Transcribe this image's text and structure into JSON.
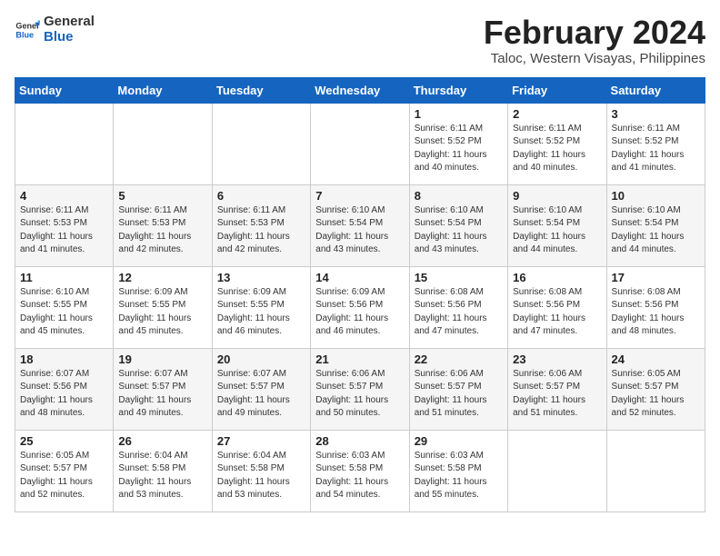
{
  "header": {
    "logo_general": "General",
    "logo_blue": "Blue",
    "month_title": "February 2024",
    "subtitle": "Taloc, Western Visayas, Philippines"
  },
  "days_of_week": [
    "Sunday",
    "Monday",
    "Tuesday",
    "Wednesday",
    "Thursday",
    "Friday",
    "Saturday"
  ],
  "weeks": [
    [
      {
        "day": "",
        "info": ""
      },
      {
        "day": "",
        "info": ""
      },
      {
        "day": "",
        "info": ""
      },
      {
        "day": "",
        "info": ""
      },
      {
        "day": "1",
        "info": "Sunrise: 6:11 AM\nSunset: 5:52 PM\nDaylight: 11 hours\nand 40 minutes."
      },
      {
        "day": "2",
        "info": "Sunrise: 6:11 AM\nSunset: 5:52 PM\nDaylight: 11 hours\nand 40 minutes."
      },
      {
        "day": "3",
        "info": "Sunrise: 6:11 AM\nSunset: 5:52 PM\nDaylight: 11 hours\nand 41 minutes."
      }
    ],
    [
      {
        "day": "4",
        "info": "Sunrise: 6:11 AM\nSunset: 5:53 PM\nDaylight: 11 hours\nand 41 minutes."
      },
      {
        "day": "5",
        "info": "Sunrise: 6:11 AM\nSunset: 5:53 PM\nDaylight: 11 hours\nand 42 minutes."
      },
      {
        "day": "6",
        "info": "Sunrise: 6:11 AM\nSunset: 5:53 PM\nDaylight: 11 hours\nand 42 minutes."
      },
      {
        "day": "7",
        "info": "Sunrise: 6:10 AM\nSunset: 5:54 PM\nDaylight: 11 hours\nand 43 minutes."
      },
      {
        "day": "8",
        "info": "Sunrise: 6:10 AM\nSunset: 5:54 PM\nDaylight: 11 hours\nand 43 minutes."
      },
      {
        "day": "9",
        "info": "Sunrise: 6:10 AM\nSunset: 5:54 PM\nDaylight: 11 hours\nand 44 minutes."
      },
      {
        "day": "10",
        "info": "Sunrise: 6:10 AM\nSunset: 5:54 PM\nDaylight: 11 hours\nand 44 minutes."
      }
    ],
    [
      {
        "day": "11",
        "info": "Sunrise: 6:10 AM\nSunset: 5:55 PM\nDaylight: 11 hours\nand 45 minutes."
      },
      {
        "day": "12",
        "info": "Sunrise: 6:09 AM\nSunset: 5:55 PM\nDaylight: 11 hours\nand 45 minutes."
      },
      {
        "day": "13",
        "info": "Sunrise: 6:09 AM\nSunset: 5:55 PM\nDaylight: 11 hours\nand 46 minutes."
      },
      {
        "day": "14",
        "info": "Sunrise: 6:09 AM\nSunset: 5:56 PM\nDaylight: 11 hours\nand 46 minutes."
      },
      {
        "day": "15",
        "info": "Sunrise: 6:08 AM\nSunset: 5:56 PM\nDaylight: 11 hours\nand 47 minutes."
      },
      {
        "day": "16",
        "info": "Sunrise: 6:08 AM\nSunset: 5:56 PM\nDaylight: 11 hours\nand 47 minutes."
      },
      {
        "day": "17",
        "info": "Sunrise: 6:08 AM\nSunset: 5:56 PM\nDaylight: 11 hours\nand 48 minutes."
      }
    ],
    [
      {
        "day": "18",
        "info": "Sunrise: 6:07 AM\nSunset: 5:56 PM\nDaylight: 11 hours\nand 48 minutes."
      },
      {
        "day": "19",
        "info": "Sunrise: 6:07 AM\nSunset: 5:57 PM\nDaylight: 11 hours\nand 49 minutes."
      },
      {
        "day": "20",
        "info": "Sunrise: 6:07 AM\nSunset: 5:57 PM\nDaylight: 11 hours\nand 49 minutes."
      },
      {
        "day": "21",
        "info": "Sunrise: 6:06 AM\nSunset: 5:57 PM\nDaylight: 11 hours\nand 50 minutes."
      },
      {
        "day": "22",
        "info": "Sunrise: 6:06 AM\nSunset: 5:57 PM\nDaylight: 11 hours\nand 51 minutes."
      },
      {
        "day": "23",
        "info": "Sunrise: 6:06 AM\nSunset: 5:57 PM\nDaylight: 11 hours\nand 51 minutes."
      },
      {
        "day": "24",
        "info": "Sunrise: 6:05 AM\nSunset: 5:57 PM\nDaylight: 11 hours\nand 52 minutes."
      }
    ],
    [
      {
        "day": "25",
        "info": "Sunrise: 6:05 AM\nSunset: 5:57 PM\nDaylight: 11 hours\nand 52 minutes."
      },
      {
        "day": "26",
        "info": "Sunrise: 6:04 AM\nSunset: 5:58 PM\nDaylight: 11 hours\nand 53 minutes."
      },
      {
        "day": "27",
        "info": "Sunrise: 6:04 AM\nSunset: 5:58 PM\nDaylight: 11 hours\nand 53 minutes."
      },
      {
        "day": "28",
        "info": "Sunrise: 6:03 AM\nSunset: 5:58 PM\nDaylight: 11 hours\nand 54 minutes."
      },
      {
        "day": "29",
        "info": "Sunrise: 6:03 AM\nSunset: 5:58 PM\nDaylight: 11 hours\nand 55 minutes."
      },
      {
        "day": "",
        "info": ""
      },
      {
        "day": "",
        "info": ""
      }
    ]
  ]
}
